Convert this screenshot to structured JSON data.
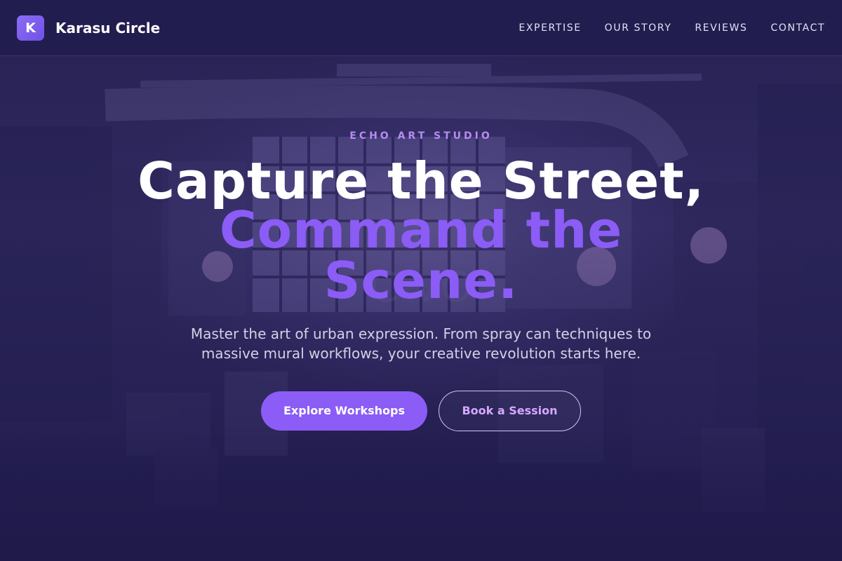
{
  "header": {
    "logo_letter": "K",
    "brand_name": "Karasu Circle",
    "nav": [
      "EXPERTISE",
      "OUR STORY",
      "REVIEWS",
      "CONTACT"
    ]
  },
  "hero": {
    "eyebrow": "ECHO ART STUDIO",
    "title_line1": "Capture the Street,",
    "title_line2": "Command the Scene.",
    "subtitle": "Master the art of urban expression. From spray can techniques to massive mural workflows, your creative revolution starts here.",
    "primary_button": "Explore Workshops",
    "secondary_button": "Book a Session"
  },
  "colors": {
    "accent": "#8b5cf6",
    "background": "#1f1a4a",
    "eyebrow": "#b58cf0",
    "secondary_button_text": "#d6a8ff"
  }
}
